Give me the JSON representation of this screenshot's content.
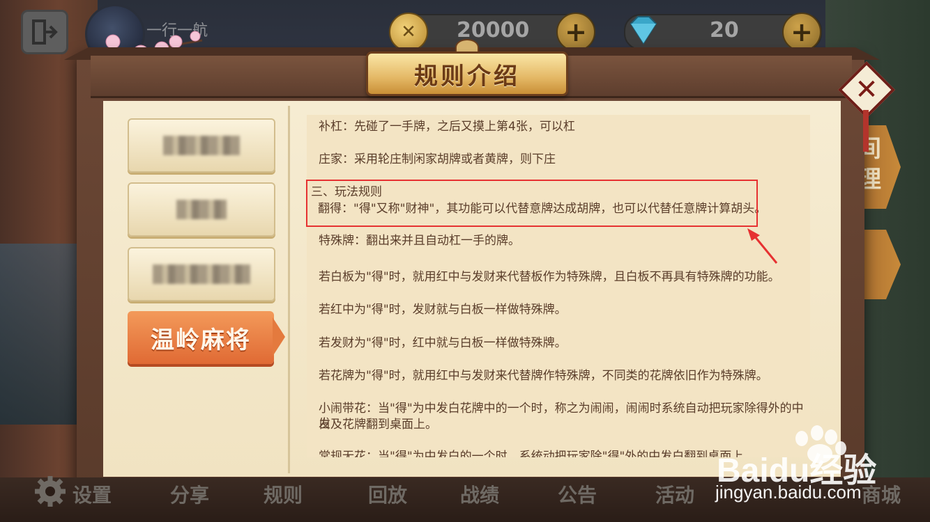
{
  "header": {
    "player_name": "一行一航",
    "gold": "20000",
    "gems": "20",
    "dialog_title": "规则介绍"
  },
  "tabs": [
    {
      "label": "",
      "blurred": true
    },
    {
      "label": "",
      "blurred": true
    },
    {
      "label": "",
      "blurred": true
    },
    {
      "label": "温岭麻将",
      "active": true
    }
  ],
  "rules": {
    "bu_gang": "补杠：先碰了一手牌，之后又摸上第4张，可以杠",
    "zhuang_jia": "庄家：采用轮庄制闲家胡牌或者黄牌，则下庄",
    "section_three": "三、玩法规则",
    "fan_de": "翻得：\"得\"又称\"财神\"，其功能可以代替意牌达成胡牌，也可以代替任意牌计算胡头。",
    "special_tile": "特殊牌：翻出来并且自动杠一手的牌。",
    "bai_ban": "若白板为\"得\"时，就用红中与发财来代替板作为特殊牌，且白板不再具有特殊牌的功能。",
    "hong_zhong": "若红中为\"得\"时，发财就与白板一样做特殊牌。",
    "fa_cai": "若发财为\"得\"时，红中就与白板一样做特殊牌。",
    "hua_pai": "若花牌为\"得\"时，就用红中与发财来代替牌作特殊牌，不同类的花牌依旧作为特殊牌。",
    "xiao_nao_1": "小闹带花：当\"得\"为中发白花牌中的一个时，称之为闹闹，闹闹时系统自动把玩家除得外的中发",
    "xiao_nao_2": "白及花牌翻到桌面上。",
    "chang_gui": "常规无花：当\"得\"为中发白的一个时，系统动把玩家除\"得\"外的中发白翻到桌面上。"
  },
  "side_menu": {
    "tab1": "间\n理"
  },
  "bottom_bar": {
    "items": [
      "设置",
      "分享",
      "规则",
      "回放",
      "战绩",
      "公告",
      "活动",
      "商城"
    ]
  },
  "watermark": {
    "logo": "Baidu经验",
    "url": "jingyan.baidu.com"
  },
  "colors": {
    "highlight": "#e63131",
    "active_tab": "#e06a34",
    "paper": "#f3e4c4"
  }
}
